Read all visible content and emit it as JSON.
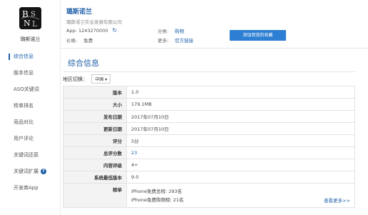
{
  "header": {
    "logo_letters": "BSNL",
    "app_name_under_logo": "璐斯诺兰",
    "app_title": "璐斯诺兰",
    "company": "璐斯诺兰实业发展有限公司",
    "app_id_label": "App:",
    "app_id_value": "1243270000",
    "price_label": "价格:",
    "price_value": "免费",
    "category_label": "分类:",
    "category_value": "购物",
    "more_label": "更多:",
    "more_value": "官方链接",
    "collect_button": "添加到我的收藏"
  },
  "sidebar": {
    "items": [
      {
        "label": "综合信息"
      },
      {
        "label": "版本信息"
      },
      {
        "label": "ASO关键词"
      },
      {
        "label": "榜单排名"
      },
      {
        "label": "竞品对比"
      },
      {
        "label": "用户评论"
      },
      {
        "label": "关键词还原"
      },
      {
        "label": "关键词扩展"
      },
      {
        "label": "开发商App"
      }
    ]
  },
  "main": {
    "section_title": "综合信息",
    "region_label": "地区切换：",
    "region_value": "中国",
    "rows": [
      {
        "key": "版本",
        "value": "1.0"
      },
      {
        "key": "大小",
        "value": "179.1MB"
      },
      {
        "key": "发布日期",
        "value": "2017年07月10日"
      },
      {
        "key": "更新日期",
        "value": "2017年07月10日"
      },
      {
        "key": "评分",
        "value": "5分"
      },
      {
        "key": "总评分数",
        "value": "23"
      },
      {
        "key": "内容评级",
        "value": "4+"
      },
      {
        "key": "系统最低版本",
        "value": "9.0"
      }
    ],
    "rank_key": "榜单",
    "rank_lines": [
      "iPhone免费总榜: 293名",
      "iPhone免费购物榜: 21名"
    ],
    "see_more": "查看更多>>"
  },
  "colors": {
    "accent": "#1e5fa8",
    "button": "#2d7fd3",
    "table_key_bg": "#f3f3f3"
  }
}
